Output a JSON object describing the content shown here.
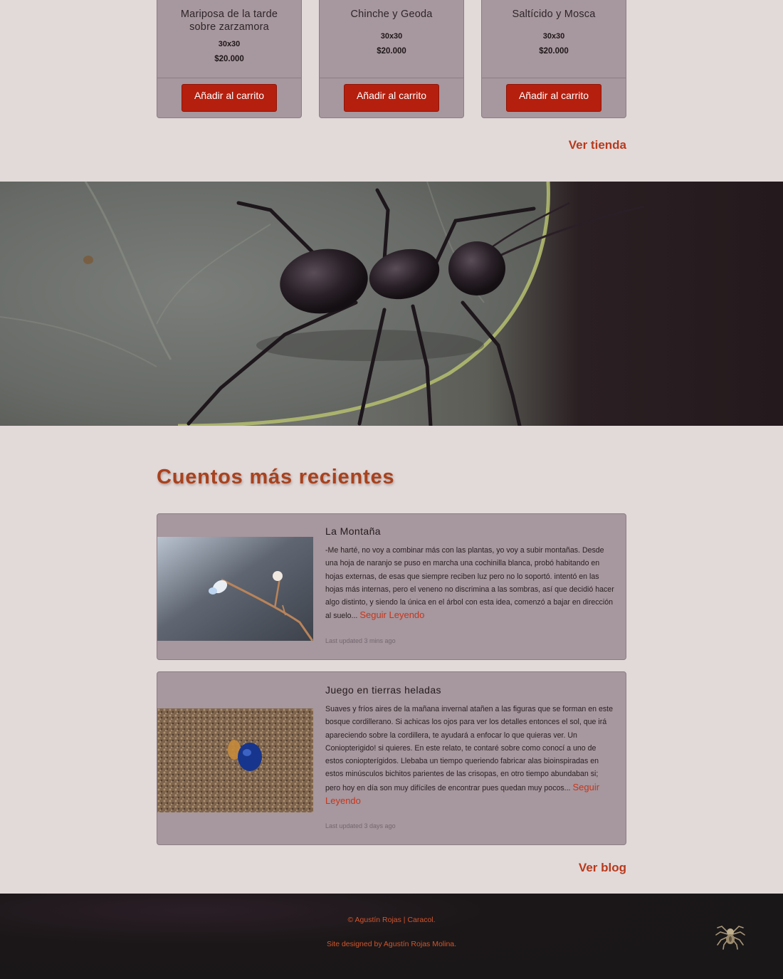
{
  "products": [
    {
      "title": "Mariposa de la tarde sobre zarzamora",
      "size": "30x30",
      "price": "$20.000",
      "button": "Añadir al carrito"
    },
    {
      "title": "Chinche y Geoda",
      "size": "30x30",
      "price": "$20.000",
      "button": "Añadir al carrito"
    },
    {
      "title": "Saltícido y Mosca",
      "size": "30x30",
      "price": "$20.000",
      "button": "Añadir al carrito"
    }
  ],
  "shop_link": "Ver tienda",
  "hero": {
    "icon": "ant-on-leaf-photo"
  },
  "stories_section": {
    "title": "Cuentos más recientes",
    "stories": [
      {
        "title": "La Montaña",
        "excerpt": "-Me harté, no voy a combinar más con las plantas, yo voy a subir montañas. Desde una hoja de naranjo se puso en marcha una cochinilla blanca, probó habitando en hojas externas, de esas que siempre reciben luz pero no lo soportó. intentó en las hojas más internas, pero el veneno no discrimina a las sombras, así que decidió hacer algo distinto, y siendo la única en el árbol con esta idea, comenzó a bajar en dirección al suelo...",
        "read_more": "Seguir Leyendo",
        "updated": "Last updated 3 mins ago"
      },
      {
        "title": "Juego en tierras heladas",
        "excerpt": "Suaves y fríos aires de la mañana invernal atañen a las figuras que se forman en este bosque cordillerano. Si achicas los ojos para ver los detalles entonces el sol, que irá apareciendo sobre la cordillera, te ayudará a enfocar lo que quieras ver. Un Coniopterigido! si quieres. En este relato, te contaré sobre como conocí a uno de estos coniopterígidos. Llebaba un tiempo queriendo fabricar alas bioinspiradas en estos minúsculos bichitos parientes de las crisopas, en otro tiempo abundaban si; pero hoy en día son muy difíciles de encontrar pues quedan muy pocos...",
        "read_more": "Seguir Leyendo",
        "updated": "Last updated 3 days ago"
      }
    ]
  },
  "blog_link": "Ver blog",
  "footer": {
    "copyright": "© Agustín Rojas | Caracol.",
    "credit": "Site designed by Agustín Rojas Molina.",
    "logo_icon": "spider-icon"
  },
  "colors": {
    "page_bg": "#e2d9d9",
    "card_bg": "#a7979e",
    "button_red": "#b51f0e",
    "accent_orange": "#b83a1c",
    "footer_bg": "#1a1718"
  }
}
